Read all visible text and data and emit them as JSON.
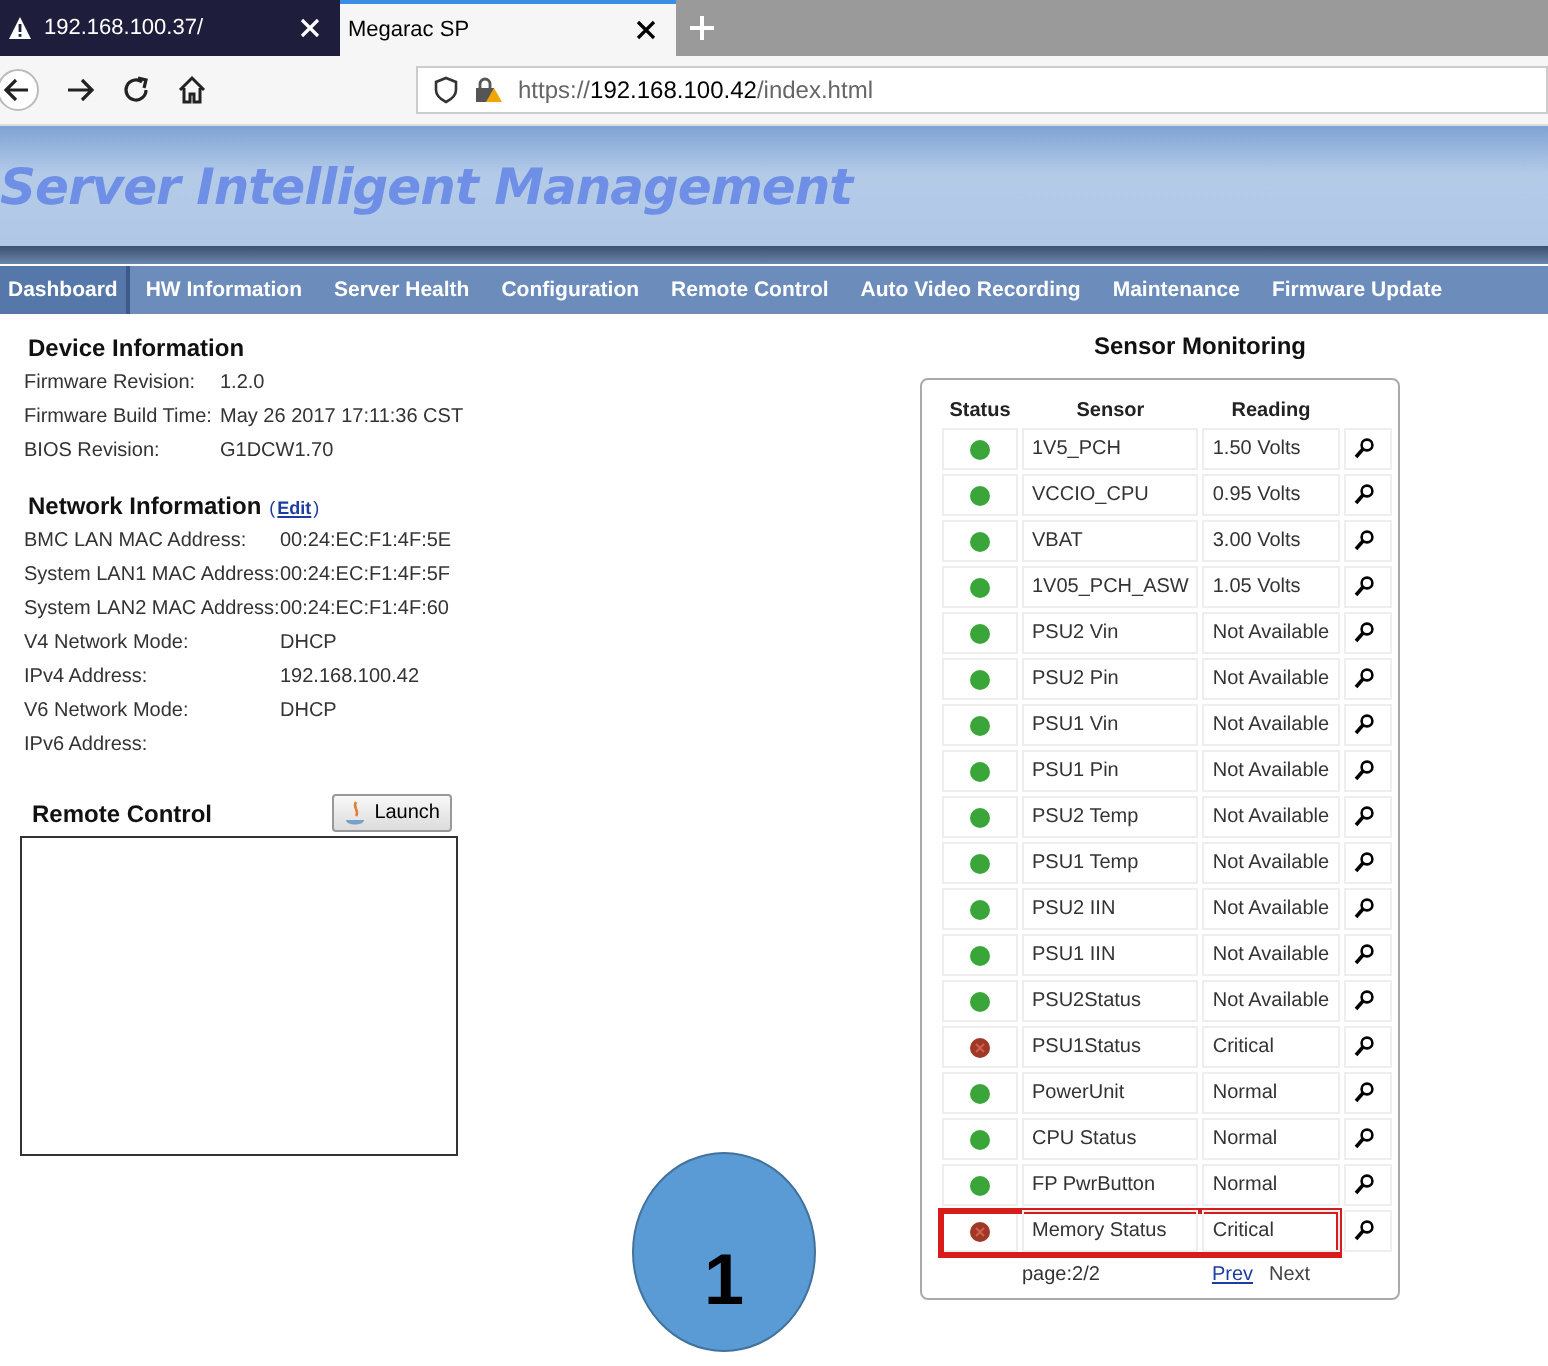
{
  "browser": {
    "tabs": [
      {
        "title": "192.168.100.37/",
        "selected": false,
        "warning": true
      },
      {
        "title": "Megarac SP",
        "selected": true,
        "warning": false
      }
    ],
    "url": {
      "prefix": "https://",
      "host": "192.168.100.42",
      "path": "/index.html"
    }
  },
  "banner": {
    "title": "Server Intelligent Management"
  },
  "nav": [
    {
      "label": "Dashboard",
      "selected": true
    },
    {
      "label": "HW Information",
      "selected": false
    },
    {
      "label": "Server Health",
      "selected": false
    },
    {
      "label": "Configuration",
      "selected": false
    },
    {
      "label": "Remote Control",
      "selected": false
    },
    {
      "label": "Auto Video Recording",
      "selected": false
    },
    {
      "label": "Maintenance",
      "selected": false
    },
    {
      "label": "Firmware Update",
      "selected": false
    }
  ],
  "device_info": {
    "heading": "Device Information",
    "rows": [
      {
        "label": "Firmware Revision:",
        "value": "1.2.0"
      },
      {
        "label": "Firmware Build Time:",
        "value": "May 26 2017 17:11:36 CST"
      },
      {
        "label": "BIOS Revision:",
        "value": "G1DCW1.70"
      }
    ]
  },
  "network_info": {
    "heading": "Network Information",
    "edit_open": "(",
    "edit_link": "Edit",
    "edit_close": ")",
    "rows": [
      {
        "label": "BMC LAN MAC Address:",
        "value": "00:24:EC:F1:4F:5E"
      },
      {
        "label": "System LAN1 MAC Address:",
        "value": "00:24:EC:F1:4F:5F"
      },
      {
        "label": "System LAN2 MAC Address:",
        "value": "00:24:EC:F1:4F:60"
      },
      {
        "label": "V4 Network Mode:",
        "value": "DHCP"
      },
      {
        "label": "IPv4 Address:",
        "value": "192.168.100.42"
      },
      {
        "label": "V6 Network Mode:",
        "value": "DHCP"
      },
      {
        "label": "IPv6 Address:"
      }
    ]
  },
  "remote_control": {
    "heading": "Remote Control",
    "button": "Launch"
  },
  "sensor_monitoring": {
    "heading": "Sensor Monitoring",
    "columns": [
      "Status",
      "Sensor",
      "Reading"
    ],
    "rows": [
      {
        "kind": "normal",
        "sensor": "1V5_PCH",
        "reading": "1.50 Volts",
        "highlighted": false
      },
      {
        "kind": "normal",
        "sensor": "VCCIO_CPU",
        "reading": "0.95 Volts",
        "highlighted": false
      },
      {
        "kind": "normal",
        "sensor": "VBAT",
        "reading": "3.00 Volts",
        "highlighted": false
      },
      {
        "kind": "normal",
        "sensor": "1V05_PCH_ASW",
        "reading": "1.05 Volts",
        "highlighted": false
      },
      {
        "kind": "normal",
        "sensor": "PSU2 Vin",
        "reading": "Not Available",
        "highlighted": false
      },
      {
        "kind": "normal",
        "sensor": "PSU2 Pin",
        "reading": "Not Available",
        "highlighted": false
      },
      {
        "kind": "normal",
        "sensor": "PSU1 Vin",
        "reading": "Not Available",
        "highlighted": false
      },
      {
        "kind": "normal",
        "sensor": "PSU1 Pin",
        "reading": "Not Available",
        "highlighted": false
      },
      {
        "kind": "normal",
        "sensor": "PSU2 Temp",
        "reading": "Not Available",
        "highlighted": false
      },
      {
        "kind": "normal",
        "sensor": "PSU1 Temp",
        "reading": "Not Available",
        "highlighted": false
      },
      {
        "kind": "normal",
        "sensor": "PSU2 IIN",
        "reading": "Not Available",
        "highlighted": false
      },
      {
        "kind": "normal",
        "sensor": "PSU1 IIN",
        "reading": "Not Available",
        "highlighted": false
      },
      {
        "kind": "normal",
        "sensor": "PSU2Status",
        "reading": "Not Available",
        "highlighted": false
      },
      {
        "kind": "critical",
        "sensor": "PSU1Status",
        "reading": "Critical",
        "highlighted": false
      },
      {
        "kind": "normal",
        "sensor": "PowerUnit",
        "reading": "Normal",
        "highlighted": false
      },
      {
        "kind": "normal",
        "sensor": "CPU Status",
        "reading": "Normal",
        "highlighted": false
      },
      {
        "kind": "normal",
        "sensor": "FP PwrButton",
        "reading": "Normal",
        "highlighted": false
      },
      {
        "kind": "critical",
        "sensor": "Memory Status",
        "reading": "Critical",
        "highlighted": true
      }
    ],
    "page": "page:2/2",
    "prev": "Prev",
    "next": "Next"
  },
  "callout": {
    "label": "1"
  }
}
